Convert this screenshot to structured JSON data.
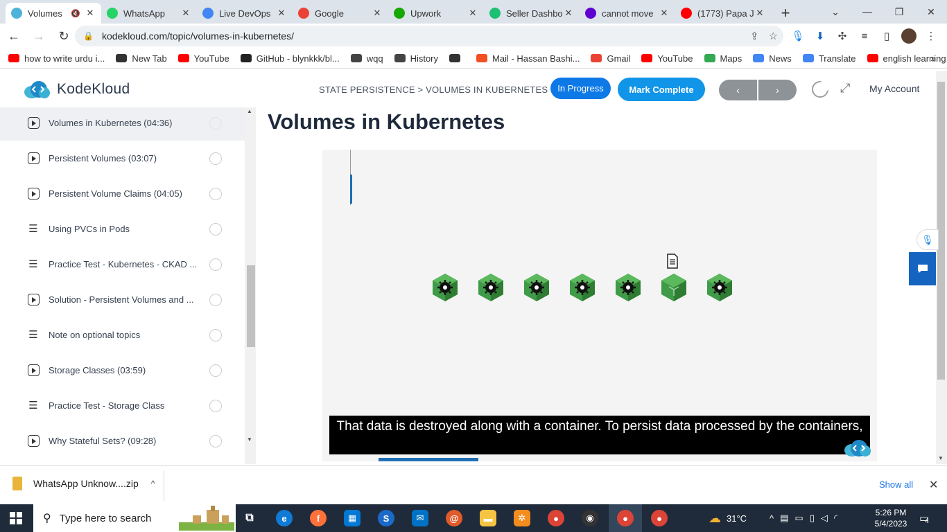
{
  "browser": {
    "tabs": [
      {
        "title": "Volumes",
        "favicon_color": "#4fb3d9",
        "active": true,
        "muted": true
      },
      {
        "title": "WhatsApp",
        "favicon_color": "#25d366"
      },
      {
        "title": "Live DevOps",
        "favicon_color": "#4285f4"
      },
      {
        "title": "Google",
        "favicon_color": "#ea4335"
      },
      {
        "title": "Upwork",
        "favicon_color": "#14a800"
      },
      {
        "title": "Seller Dashbo",
        "favicon_color": "#1dbf73"
      },
      {
        "title": "cannot move",
        "favicon_color": "#6001d2"
      },
      {
        "title": "(1773) Papa J",
        "favicon_color": "#ff0000"
      }
    ],
    "url": "kodekloud.com/topic/volumes-in-kubernetes/",
    "bookmarks": [
      {
        "label": "how to write urdu i...",
        "color": "#ff0000"
      },
      {
        "label": "New Tab",
        "color": "#333333"
      },
      {
        "label": "YouTube",
        "color": "#ff0000"
      },
      {
        "label": "GitHub - blynkkk/bl...",
        "color": "#222222"
      },
      {
        "label": "wqq",
        "color": "#444444"
      },
      {
        "label": "History",
        "color": "#444444"
      },
      {
        "label": "",
        "color": "#333333"
      },
      {
        "label": "Mail - Hassan Bashi...",
        "color": "#f25022"
      },
      {
        "label": "Gmail",
        "color": "#ea4335"
      },
      {
        "label": "YouTube",
        "color": "#ff0000"
      },
      {
        "label": "Maps",
        "color": "#34a853"
      },
      {
        "label": "News",
        "color": "#4285f4"
      },
      {
        "label": "Translate",
        "color": "#4285f4"
      },
      {
        "label": "english learning",
        "color": "#ff0000"
      }
    ]
  },
  "header": {
    "logo": "KodeKloud",
    "breadcrumb": "STATE PERSISTENCE > VOLUMES IN KUBERNETES",
    "in_progress": "In Progress",
    "mark_complete": "Mark Complete",
    "prev": "‹",
    "next": "›",
    "account": "My Account"
  },
  "sidebar": {
    "lessons": [
      {
        "label": "Volumes in Kubernetes (04:36)",
        "type": "video",
        "current": true
      },
      {
        "label": "Persistent Volumes (03:07)",
        "type": "video"
      },
      {
        "label": "Persistent Volume Claims (04:05)",
        "type": "video"
      },
      {
        "label": "Using PVCs in Pods",
        "type": "text"
      },
      {
        "label": "Practice Test - Kubernetes - CKAD ...",
        "type": "text"
      },
      {
        "label": "Solution - Persistent Volumes and ...",
        "type": "video"
      },
      {
        "label": "Note on optional topics",
        "type": "text"
      },
      {
        "label": "Storage Classes (03:59)",
        "type": "video"
      },
      {
        "label": "Practice Test - Storage Class",
        "type": "text"
      },
      {
        "label": "Why Stateful Sets? (09:28)",
        "type": "video"
      }
    ]
  },
  "main": {
    "title": "Volumes in Kubernetes",
    "caption": "That data is destroyed along with a container. To persist data processed by the containers,",
    "video_progress": 0.18
  },
  "downloads": {
    "file": "WhatsApp Unknow....zip",
    "show_all": "Show all"
  },
  "taskbar": {
    "search_placeholder": "Type here to search",
    "temperature": "31°C",
    "time": "5:26 PM",
    "date": "5/4/2023",
    "notifications": "4"
  }
}
